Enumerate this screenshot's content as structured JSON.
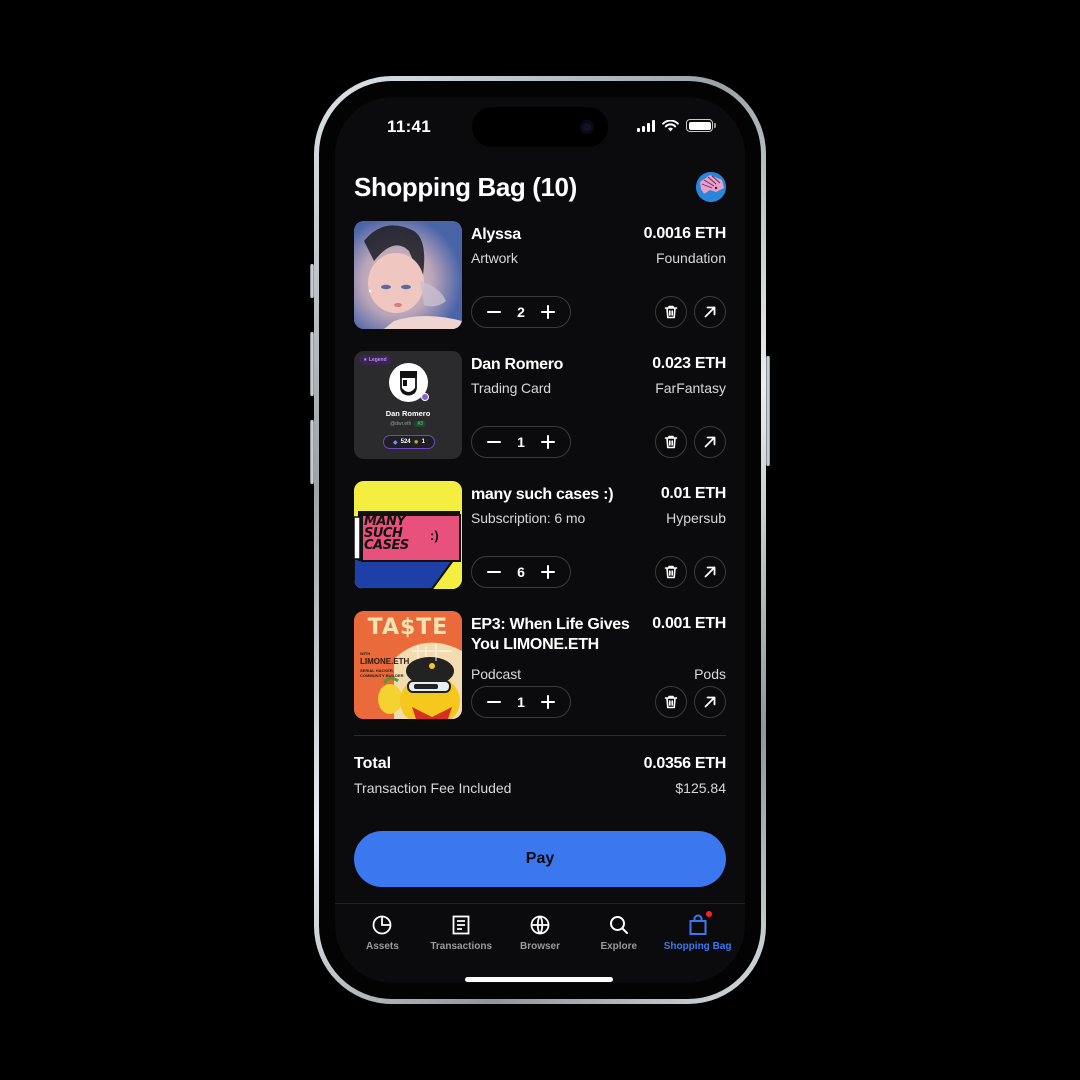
{
  "status_bar": {
    "time": "11:41"
  },
  "header": {
    "title": "Shopping Bag (10)",
    "avatar": "user-avatar"
  },
  "items": [
    {
      "name": "Alyssa",
      "type": "Artwork",
      "price": "0.0016 ETH",
      "source": "Foundation",
      "quantity": "2",
      "image": "alyssa-artwork"
    },
    {
      "name": "Dan Romero",
      "type": "Trading Card",
      "price": "0.023 ETH",
      "source": "FarFantasy",
      "quantity": "1",
      "image": "dan-romero-card",
      "card": {
        "badge": "Legend",
        "name": "Dan Romero",
        "handle": "@dwr.eth",
        "rank": "#3",
        "points": "524",
        "medals": "1"
      }
    },
    {
      "name": "many such cases :)",
      "type": "Subscription: 6 mo",
      "price": "0.01 ETH",
      "source": "Hypersub",
      "quantity": "6",
      "image": "many-such-cases-cover",
      "cover": {
        "line1": "MANY",
        "line2": "SUCH",
        "line3": "CASES",
        "smile": ":)"
      }
    },
    {
      "name": "EP3: When Life Gives You LIMONE.ETH",
      "type": "Podcast",
      "price": "0.001 ETH",
      "source": "Pods",
      "quantity": "1",
      "image": "taste-podcast-cover",
      "cover": {
        "title": "TA$TE",
        "with": "WITH",
        "guest": "LIMONE.ETH",
        "sub1": "SERIAL HACKER,",
        "sub2": "COMMUNITY BUILDER"
      }
    }
  ],
  "summary": {
    "total_label": "Total",
    "fee_label": "Transaction Fee Included",
    "total_eth": "0.0356 ETH",
    "total_usd": "$125.84"
  },
  "pay_button": "Pay",
  "tabs": [
    {
      "label": "Assets",
      "icon": "pie-chart-icon",
      "active": false
    },
    {
      "label": "Transactions",
      "icon": "document-icon",
      "active": false
    },
    {
      "label": "Browser",
      "icon": "globe-icon",
      "active": false
    },
    {
      "label": "Explore",
      "icon": "search-icon",
      "active": false
    },
    {
      "label": "Shopping Bag",
      "icon": "shopping-bag-icon",
      "active": true,
      "badge": true
    }
  ],
  "colors": {
    "accent": "#3b78f0",
    "background": "#0b0b0d",
    "badge": "#ff2020"
  }
}
